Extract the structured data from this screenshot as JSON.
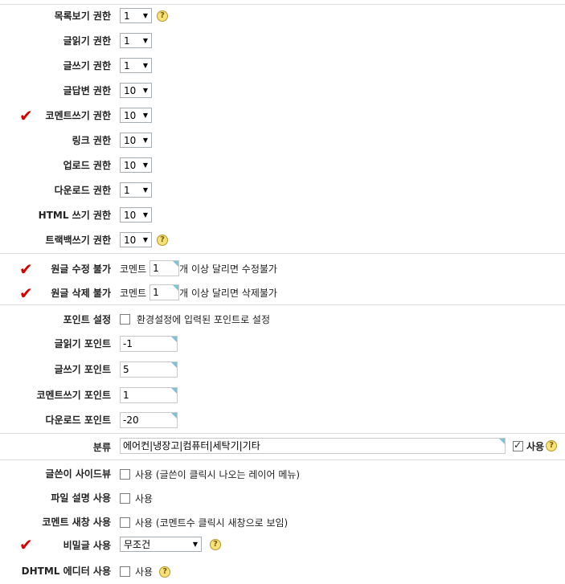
{
  "permissions": [
    {
      "label": "목록보기 권한",
      "value": "1",
      "help": true,
      "required": false
    },
    {
      "label": "글읽기 권한",
      "value": "1",
      "help": false,
      "required": false
    },
    {
      "label": "글쓰기 권한",
      "value": "1",
      "help": false,
      "required": false
    },
    {
      "label": "글답변 권한",
      "value": "10",
      "help": false,
      "required": false
    },
    {
      "label": "코멘트쓰기 권한",
      "value": "10",
      "help": false,
      "required": true
    },
    {
      "label": "링크 권한",
      "value": "10",
      "help": false,
      "required": false
    },
    {
      "label": "업로드 권한",
      "value": "10",
      "help": false,
      "required": false
    },
    {
      "label": "다운로드 권한",
      "value": "1",
      "help": false,
      "required": false
    },
    {
      "label": "HTML 쓰기 권한",
      "value": "10",
      "help": false,
      "required": false
    },
    {
      "label": "트랙백쓰기 권한",
      "value": "10",
      "help": true,
      "required": false
    }
  ],
  "original_edit": {
    "label": "원글 수정 불가",
    "prefix": "코멘트",
    "value": "1",
    "suffix": "개 이상 달리면 수정불가"
  },
  "original_delete": {
    "label": "원글 삭제 불가",
    "prefix": "코멘트",
    "value": "1",
    "suffix": "개 이상 달리면 삭제불가"
  },
  "point_setting": {
    "label": "포인트 설정",
    "option": "환경설정에 입력된 포인트로 설정"
  },
  "points": [
    {
      "label": "글읽기 포인트",
      "value": "-1"
    },
    {
      "label": "글쓰기 포인트",
      "value": "5"
    },
    {
      "label": "코멘트쓰기 포인트",
      "value": "1"
    },
    {
      "label": "다운로드 포인트",
      "value": "-20"
    }
  ],
  "category": {
    "label": "분류",
    "value": "에어컨|냉장고|컴퓨터|세탁기|기타",
    "use_label": "사용"
  },
  "sideview": {
    "label": "글쓴이 사이드뷰",
    "option": "사용 (글쓴이 클릭시 나오는 레이어 메뉴)"
  },
  "file_desc": {
    "label": "파일 설명 사용",
    "option": "사용"
  },
  "comment_window": {
    "label": "코멘트 새창 사용",
    "option": "사용 (코멘트수 클릭시 새창으로 보임)"
  },
  "secret": {
    "label": "비밀글 사용",
    "value": "무조건"
  },
  "dhtml": {
    "label": "DHTML 에디터 사용",
    "option": "사용"
  },
  "help_glyph": "?",
  "check_glyph": "✔",
  "accent_color": "#d40000"
}
